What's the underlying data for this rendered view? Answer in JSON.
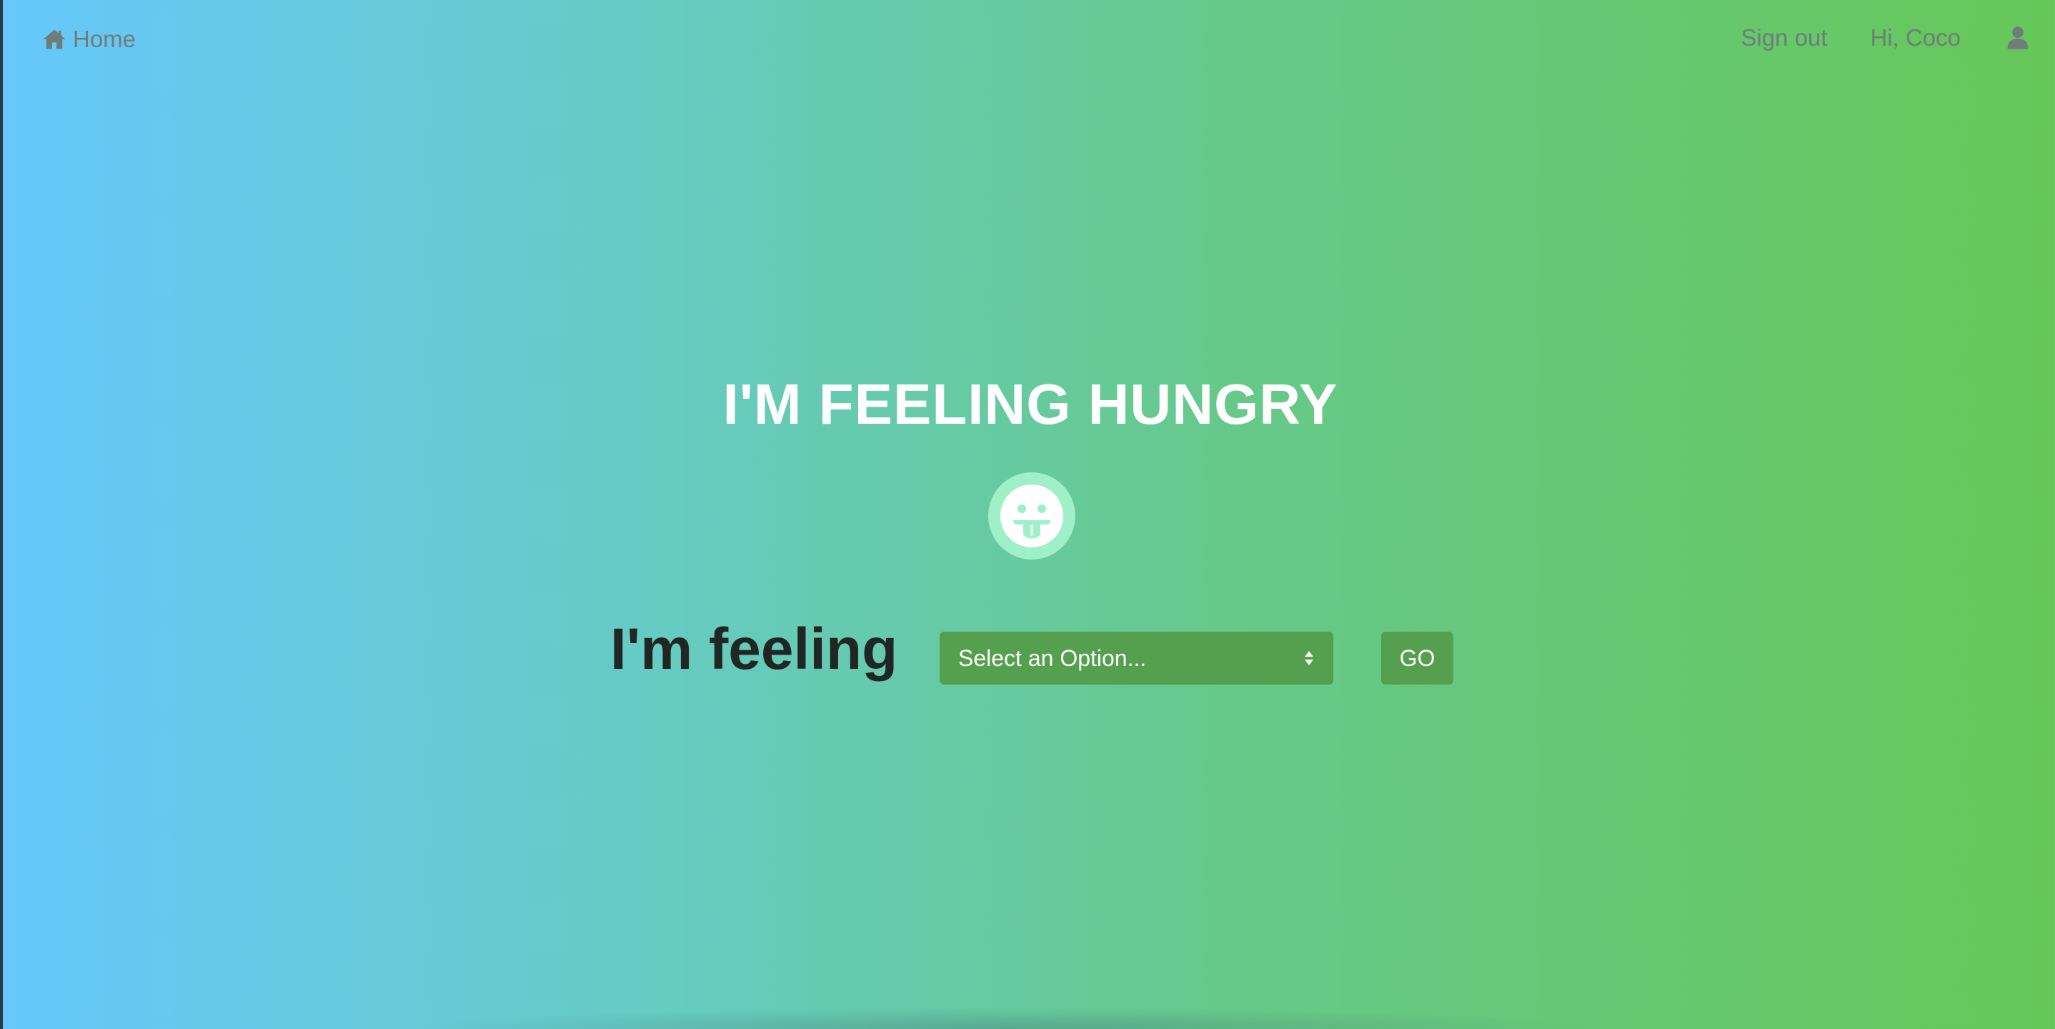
{
  "navbar": {
    "home_label": "Home",
    "home_icon": "home-icon",
    "signout_label": "Sign out",
    "greeting": "Hi, Coco",
    "user_icon": "user-icon",
    "text_color": "#6f7d7a"
  },
  "hero": {
    "title": "I'M FEELING HUNGRY",
    "emoji_icon": "tongue-out-face-icon",
    "emoji_badge_color": "#9ff0c8"
  },
  "mood_form": {
    "label": "I'm feeling",
    "select_value": "Select an Option...",
    "go_label": "GO",
    "button_color": "#55a04e"
  },
  "theme": {
    "gradient_start": "#66c8fc",
    "gradient_end": "#66c758",
    "title_color": "#ffffff"
  }
}
